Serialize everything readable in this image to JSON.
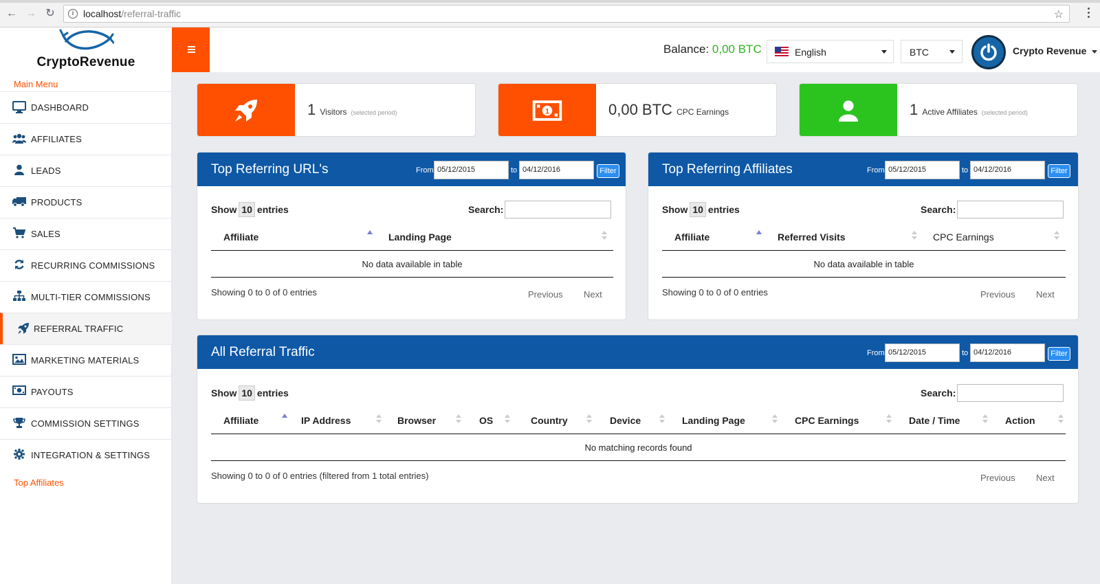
{
  "browser": {
    "url_host": "localhost",
    "url_path": "/referral-traffic"
  },
  "brand": {
    "name": "CryptoRevenue",
    "accent": "#fe5000",
    "primary": "#0e58a6",
    "green": "#2bb51d"
  },
  "header": {
    "balance_label": "Balance:",
    "balance_value": "0,00 BTC",
    "language": "English",
    "currency": "BTC",
    "user_name": "Crypto Revenue"
  },
  "sidebar": {
    "main_menu_title": "Main Menu",
    "top_affiliates_title": "Top Affiliates",
    "items": [
      {
        "label": "DASHBOARD",
        "icon": "monitor-icon"
      },
      {
        "label": "AFFILIATES",
        "icon": "users-icon"
      },
      {
        "label": "LEADS",
        "icon": "user-icon"
      },
      {
        "label": "PRODUCTS",
        "icon": "truck-icon"
      },
      {
        "label": "SALES",
        "icon": "cart-icon"
      },
      {
        "label": "RECURRING COMMISSIONS",
        "icon": "refresh-icon"
      },
      {
        "label": "MULTI-TIER COMMISSIONS",
        "icon": "sitemap-icon"
      },
      {
        "label": "REFERRAL TRAFFIC",
        "icon": "rocket-icon",
        "active": true
      },
      {
        "label": "MARKETING MATERIALS",
        "icon": "image-icon"
      },
      {
        "label": "PAYOUTS",
        "icon": "money-icon"
      },
      {
        "label": "COMMISSION SETTINGS",
        "icon": "trophy-icon"
      },
      {
        "label": "INTEGRATION & SETTINGS",
        "icon": "gear-icon"
      }
    ]
  },
  "stats": [
    {
      "value": "1",
      "label": "Visitors",
      "sub": "(selected period)",
      "icon": "rocket-icon",
      "color": "#fe5000"
    },
    {
      "value": "0,00 BTC",
      "label": "CPC Earnings",
      "sub": "",
      "icon": "money-icon",
      "color": "#fe5000"
    },
    {
      "value": "1",
      "label": "Active Affiliates",
      "sub": "(selected period)",
      "icon": "user-icon",
      "color": "#2bc41e"
    }
  ],
  "panels": {
    "top_urls": {
      "title": "Top Referring URL's",
      "from_label": "From",
      "to_label": "to",
      "from_date": "05/12/2015",
      "to_date": "04/12/2016",
      "filter_label": "Filter",
      "show_label": "Show",
      "show_count": "10",
      "entries_label": "entries",
      "search_label": "Search:",
      "columns": [
        "Affiliate",
        "Landing Page"
      ],
      "empty_text": "No data available in table",
      "showing_text": "Showing 0 to 0 of 0 entries",
      "prev_label": "Previous",
      "next_label": "Next"
    },
    "top_affiliates": {
      "title": "Top Referring Affiliates",
      "from_label": "From",
      "to_label": "to",
      "from_date": "05/12/2015",
      "to_date": "04/12/2016",
      "filter_label": "Filter",
      "show_label": "Show",
      "show_count": "10",
      "entries_label": "entries",
      "search_label": "Search:",
      "columns": [
        "Affiliate",
        "Referred Visits",
        "CPC Earnings"
      ],
      "empty_text": "No data available in table",
      "showing_text": "Showing 0 to 0 of 0 entries",
      "prev_label": "Previous",
      "next_label": "Next"
    },
    "all_traffic": {
      "title": "All Referral Traffic",
      "from_label": "From",
      "to_label": "to",
      "from_date": "05/12/2015",
      "to_date": "04/12/2016",
      "filter_label": "Filter",
      "show_label": "Show",
      "show_count": "10",
      "entries_label": "entries",
      "search_label": "Search:",
      "columns": [
        "Affiliate",
        "IP Address",
        "Browser",
        "OS",
        "Country",
        "Device",
        "Landing Page",
        "CPC Earnings",
        "Date / Time",
        "Action"
      ],
      "empty_text": "No matching records found",
      "showing_text": "Showing 0 to 0 of 0 entries (filtered from 1 total entries)",
      "prev_label": "Previous",
      "next_label": "Next"
    }
  }
}
